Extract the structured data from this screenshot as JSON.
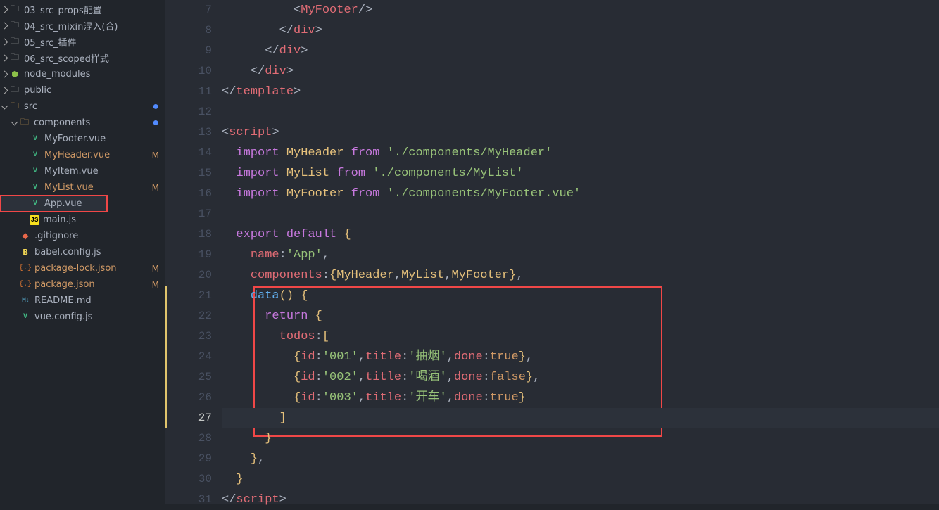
{
  "sidebar": {
    "items": [
      {
        "indent": 0,
        "arrow": "closed",
        "icon": "folder-g",
        "iconChar": "🗀",
        "label": "03_src_props配置",
        "status": "",
        "cls": ""
      },
      {
        "indent": 0,
        "arrow": "closed",
        "icon": "folder-g",
        "iconChar": "🗀",
        "label": "04_src_mixin混入(合)",
        "status": "",
        "cls": ""
      },
      {
        "indent": 0,
        "arrow": "closed",
        "icon": "folder-g",
        "iconChar": "🗀",
        "label": "05_src_插件",
        "status": "",
        "cls": ""
      },
      {
        "indent": 0,
        "arrow": "closed",
        "icon": "folder-g",
        "iconChar": "🗀",
        "label": "06_src_scoped样式",
        "status": "",
        "cls": ""
      },
      {
        "indent": 0,
        "arrow": "closed",
        "icon": "node",
        "iconChar": "⬢",
        "label": "node_modules",
        "status": "",
        "cls": ""
      },
      {
        "indent": 0,
        "arrow": "closed",
        "icon": "folder-g",
        "iconChar": "🗀",
        "label": "public",
        "status": "",
        "cls": ""
      },
      {
        "indent": 0,
        "arrow": "open",
        "icon": "folder",
        "iconChar": "🗀",
        "label": "src",
        "status": "●",
        "cls": ""
      },
      {
        "indent": 1,
        "arrow": "open",
        "icon": "folder",
        "iconChar": "🗀",
        "label": "components",
        "status": "●",
        "cls": ""
      },
      {
        "indent": 2,
        "arrow": "none",
        "icon": "vue",
        "iconChar": "V",
        "label": "MyFooter.vue",
        "status": "",
        "cls": ""
      },
      {
        "indent": 2,
        "arrow": "none",
        "icon": "vue",
        "iconChar": "V",
        "label": "MyHeader.vue",
        "status": "M",
        "cls": "mod"
      },
      {
        "indent": 2,
        "arrow": "none",
        "icon": "vue",
        "iconChar": "V",
        "label": "MyItem.vue",
        "status": "",
        "cls": ""
      },
      {
        "indent": 2,
        "arrow": "none",
        "icon": "vue",
        "iconChar": "V",
        "label": "MyList.vue",
        "status": "M",
        "cls": "mod"
      },
      {
        "indent": 2,
        "arrow": "none",
        "icon": "vue",
        "iconChar": "V",
        "label": "App.vue",
        "status": "",
        "cls": "hlred selected"
      },
      {
        "indent": 2,
        "arrow": "none",
        "icon": "js",
        "iconChar": "JS",
        "label": "main.js",
        "status": "",
        "cls": ""
      },
      {
        "indent": 1,
        "arrow": "none",
        "icon": "git",
        "iconChar": "◆",
        "label": ".gitignore",
        "status": "",
        "cls": ""
      },
      {
        "indent": 1,
        "arrow": "none",
        "icon": "babel",
        "iconChar": "B",
        "label": "babel.config.js",
        "status": "",
        "cls": ""
      },
      {
        "indent": 1,
        "arrow": "none",
        "icon": "json",
        "iconChar": "{.}",
        "label": "package-lock.json",
        "status": "M",
        "cls": "mod"
      },
      {
        "indent": 1,
        "arrow": "none",
        "icon": "json",
        "iconChar": "{.}",
        "label": "package.json",
        "status": "M",
        "cls": "mod"
      },
      {
        "indent": 1,
        "arrow": "none",
        "icon": "md",
        "iconChar": "M↓",
        "label": "README.md",
        "status": "",
        "cls": ""
      },
      {
        "indent": 1,
        "arrow": "none",
        "icon": "vue",
        "iconChar": "V",
        "label": "vue.config.js",
        "status": "",
        "cls": ""
      }
    ]
  },
  "editor": {
    "startLine": 7,
    "activeLine": 27,
    "hl_start": 21,
    "hl_end": 27,
    "lines": [
      "          <MyFooter/>",
      "        </div>",
      "      </div>",
      "    </div>",
      "</template>",
      "",
      "<script>",
      "  import MyHeader from './components/MyHeader'",
      "  import MyList from './components/MyList'",
      "  import MyFooter from './components/MyFooter.vue'",
      "",
      "  export default {",
      "    name:'App',",
      "    components:{MyHeader,MyList,MyFooter},",
      "    data() {",
      "      return {",
      "        todos:[",
      "          {id:'001',title:'抽烟',done:true},",
      "          {id:'002',title:'喝酒',done:false},",
      "          {id:'003',title:'开车',done:true}",
      "        ]",
      "      }",
      "    },",
      "  }",
      "</script>"
    ]
  }
}
